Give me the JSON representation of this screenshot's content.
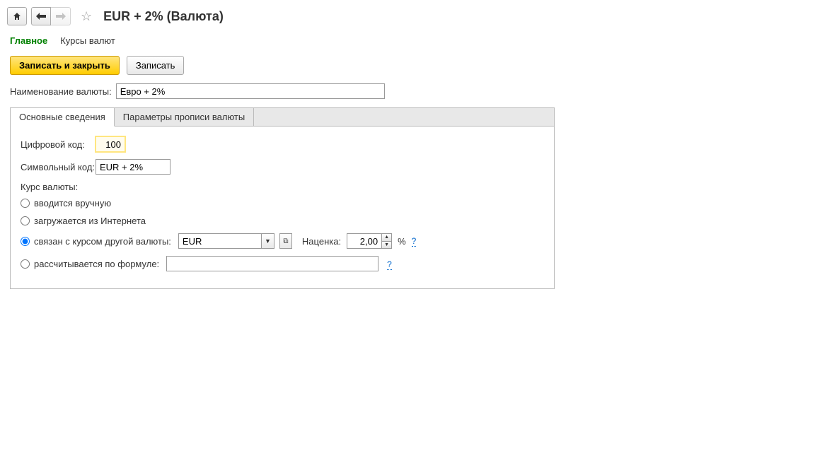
{
  "toolbar": {
    "title": "EUR + 2% (Валюта)"
  },
  "nav": {
    "tab_main": "Главное",
    "tab_rates": "Курсы валют"
  },
  "buttons": {
    "save_close": "Записать и закрыть",
    "save": "Записать"
  },
  "form": {
    "name_label": "Наименование валюты:",
    "name_value": "Евро + 2%"
  },
  "tabs": {
    "basic": "Основные сведения",
    "params": "Параметры прописи валюты"
  },
  "fields": {
    "numeric_code_label": "Цифровой код:",
    "numeric_code_value": "100",
    "symbol_code_label": "Символьный код:",
    "symbol_code_value": "EUR + 2%",
    "rate_label": "Курс валюты:",
    "radio_manual": "вводится вручную",
    "radio_internet": "загружается из Интернета",
    "radio_linked": "связан с курсом другой валюты:",
    "radio_formula": "рассчитывается по формуле:",
    "linked_currency": "EUR",
    "markup_label": "Наценка:",
    "markup_value": "2,00",
    "percent_symbol": "%",
    "help": "?"
  }
}
